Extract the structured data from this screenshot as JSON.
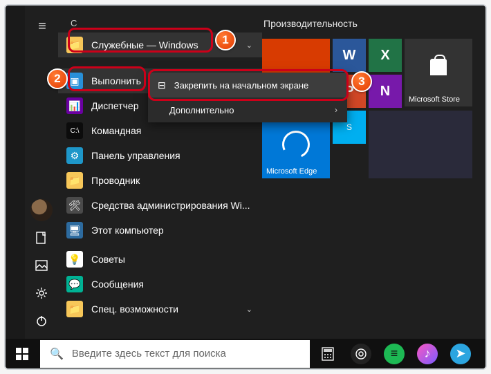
{
  "letterHeader": "С",
  "apps": {
    "folder": "Служебные — Windows",
    "run": "Выполнить",
    "taskmgr": "Диспетчер",
    "cmd": "Командная",
    "cpanel": "Панель управления",
    "explorer": "Проводник",
    "admintools": "Средства администрирования Wi...",
    "thispc": "Этот компьютер",
    "tips": "Советы",
    "messages": "Сообщения",
    "ease": "Спец. возможности"
  },
  "tiles": {
    "header": "Производительность",
    "edge": "Microsoft Edge",
    "store": "Microsoft Store"
  },
  "context": {
    "pin": "Закрепить на начальном экране",
    "more": "Дополнительно"
  },
  "search": {
    "placeholder": "Введите здесь текст для поиска"
  },
  "badges": {
    "one": "1",
    "two": "2",
    "three": "3"
  }
}
